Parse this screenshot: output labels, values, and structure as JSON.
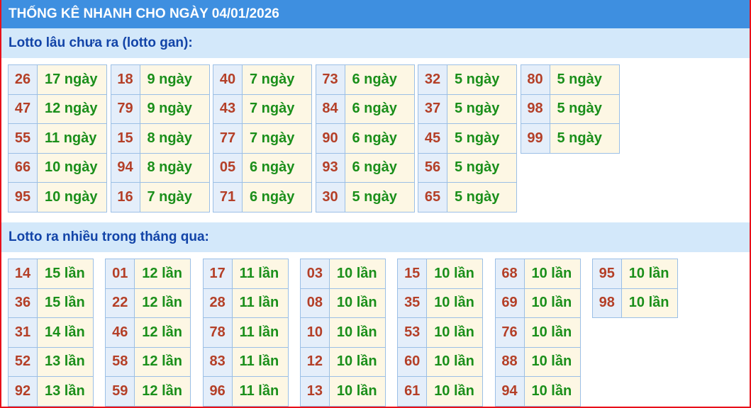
{
  "header": {
    "title": "THỐNG KÊ NHANH CHO NGÀY 04/01/2026"
  },
  "gan": {
    "title": "Lotto lâu chưa ra (lotto gan):",
    "groups": [
      [
        [
          "26",
          "17 ngày"
        ],
        [
          "47",
          "12 ngày"
        ],
        [
          "55",
          "11 ngày"
        ],
        [
          "66",
          "10 ngày"
        ],
        [
          "95",
          "10 ngày"
        ]
      ],
      [
        [
          "18",
          "9 ngày"
        ],
        [
          "79",
          "9 ngày"
        ],
        [
          "15",
          "8 ngày"
        ],
        [
          "94",
          "8 ngày"
        ],
        [
          "16",
          "7 ngày"
        ]
      ],
      [
        [
          "40",
          "7 ngày"
        ],
        [
          "43",
          "7 ngày"
        ],
        [
          "77",
          "7 ngày"
        ],
        [
          "05",
          "6 ngày"
        ],
        [
          "71",
          "6 ngày"
        ]
      ],
      [
        [
          "73",
          "6 ngày"
        ],
        [
          "84",
          "6 ngày"
        ],
        [
          "90",
          "6 ngày"
        ],
        [
          "93",
          "6 ngày"
        ],
        [
          "30",
          "5 ngày"
        ]
      ],
      [
        [
          "32",
          "5 ngày"
        ],
        [
          "37",
          "5 ngày"
        ],
        [
          "45",
          "5 ngày"
        ],
        [
          "56",
          "5 ngày"
        ],
        [
          "65",
          "5 ngày"
        ]
      ],
      [
        [
          "80",
          "5 ngày"
        ],
        [
          "98",
          "5 ngày"
        ],
        [
          "99",
          "5 ngày"
        ]
      ]
    ]
  },
  "nhieu": {
    "title": "Lotto ra nhiều trong tháng qua:",
    "groups": [
      [
        [
          "14",
          "15 lần"
        ],
        [
          "36",
          "15 lần"
        ],
        [
          "31",
          "14 lần"
        ],
        [
          "52",
          "13 lần"
        ],
        [
          "92",
          "13 lần"
        ]
      ],
      [
        [
          "01",
          "12 lần"
        ],
        [
          "22",
          "12 lần"
        ],
        [
          "46",
          "12 lần"
        ],
        [
          "58",
          "12 lần"
        ],
        [
          "59",
          "12 lần"
        ]
      ],
      [
        [
          "17",
          "11 lần"
        ],
        [
          "28",
          "11 lần"
        ],
        [
          "78",
          "11 lần"
        ],
        [
          "83",
          "11 lần"
        ],
        [
          "96",
          "11 lần"
        ]
      ],
      [
        [
          "03",
          "10 lần"
        ],
        [
          "08",
          "10 lần"
        ],
        [
          "10",
          "10 lần"
        ],
        [
          "12",
          "10 lần"
        ],
        [
          "13",
          "10 lần"
        ]
      ],
      [
        [
          "15",
          "10 lần"
        ],
        [
          "35",
          "10 lần"
        ],
        [
          "53",
          "10 lần"
        ],
        [
          "60",
          "10 lần"
        ],
        [
          "61",
          "10 lần"
        ]
      ],
      [
        [
          "68",
          "10 lần"
        ],
        [
          "69",
          "10 lần"
        ],
        [
          "76",
          "10 lần"
        ],
        [
          "88",
          "10 lần"
        ],
        [
          "94",
          "10 lần"
        ]
      ],
      [
        [
          "95",
          "10 lần"
        ],
        [
          "98",
          "10 lần"
        ]
      ]
    ]
  }
}
